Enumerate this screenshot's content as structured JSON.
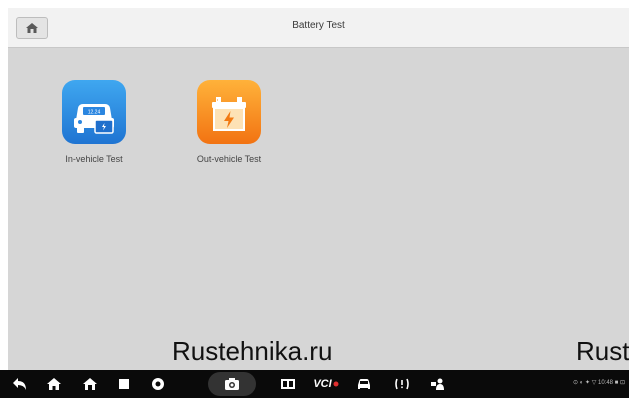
{
  "header": {
    "title": "Battery Test"
  },
  "apps": [
    {
      "label": "In-vehicle Test",
      "icon": "in-vehicle-test-icon",
      "color": "#2b8de6"
    },
    {
      "label": "Out-vehicle Test",
      "icon": "out-vehicle-test-icon",
      "color": "#f7921e"
    }
  ],
  "watermark": {
    "text1": "Rustehnika.ru",
    "text2": "Rustehnika.ru"
  },
  "navbar": {
    "vcl_label": "VCI",
    "status_text": "⊙ ◐ ✦ ▽ 10:48 ■ ⊡"
  }
}
